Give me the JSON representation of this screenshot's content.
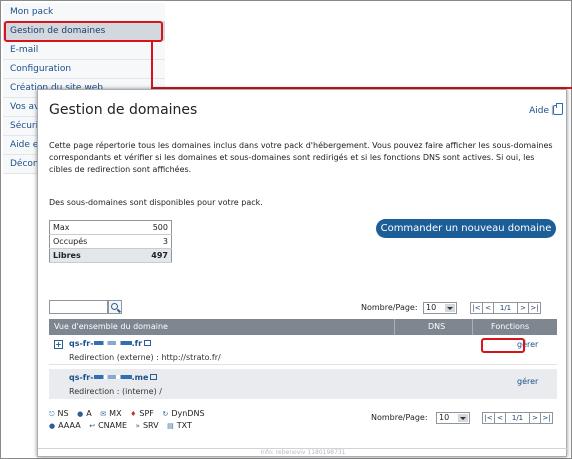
{
  "sidebar": {
    "items": [
      {
        "label": "Mon pack"
      },
      {
        "label": "Gestion de domaines"
      },
      {
        "label": "E-mail"
      },
      {
        "label": "Configuration"
      },
      {
        "label": "Création du site web"
      },
      {
        "label": "Vos av"
      },
      {
        "label": "Sécuri"
      },
      {
        "label": "Aide e"
      },
      {
        "label": "Décon"
      }
    ]
  },
  "page": {
    "title": "Gestion de domaines",
    "help_label": "Aide",
    "help_separator": "|",
    "intro": "Cette page répertorie tous les domaines inclus dans votre pack d'hébergement. Vous pouvez faire afficher les sous-domaines correspondants et vérifier si les domaines et sous-domaines sont redirigés et si les fonctions DNS sont actives. Si oui, les cibles de redirection sont affichées.",
    "subdomain_info": "Des sous-domaines sont disponibles pour votre pack."
  },
  "quota": {
    "rows": [
      {
        "label": "Max",
        "value": "500"
      },
      {
        "label": "Occupés",
        "value": "3"
      },
      {
        "label": "Libres",
        "value": "497"
      }
    ]
  },
  "order_button_label": "Commander un nouveau domaine",
  "per_page": {
    "label": "Nombre/Page:",
    "value": "10",
    "pager": {
      "first": "|<",
      "prev": "<",
      "page": "1/1",
      "next": ">",
      "last": ">|"
    }
  },
  "grid": {
    "columns": [
      "Vue d'ensemble du domaine",
      "DNS",
      "Fonctions"
    ],
    "rows": [
      {
        "name_prefix": "qs-fr-",
        "name_suffix": ".fr",
        "redirect": "Redirection (externe) : http://strato.fr/",
        "action": "gérer"
      },
      {
        "name_prefix": "qs-fr-",
        "name_suffix": ".me",
        "redirect": "Redirection : (interne) /",
        "action": "gérer"
      }
    ]
  },
  "legend": {
    "items": [
      "NS",
      "A",
      "MX",
      "SPF",
      "DynDNS",
      "AAAA",
      "CNAME",
      "SRV",
      "TXT"
    ]
  },
  "footer": {
    "text": "Info: rebenoviv 1180198731"
  },
  "colors": {
    "accent": "#1c5f98",
    "highlight": "#d8141b",
    "grid_header": "#7e8690"
  }
}
